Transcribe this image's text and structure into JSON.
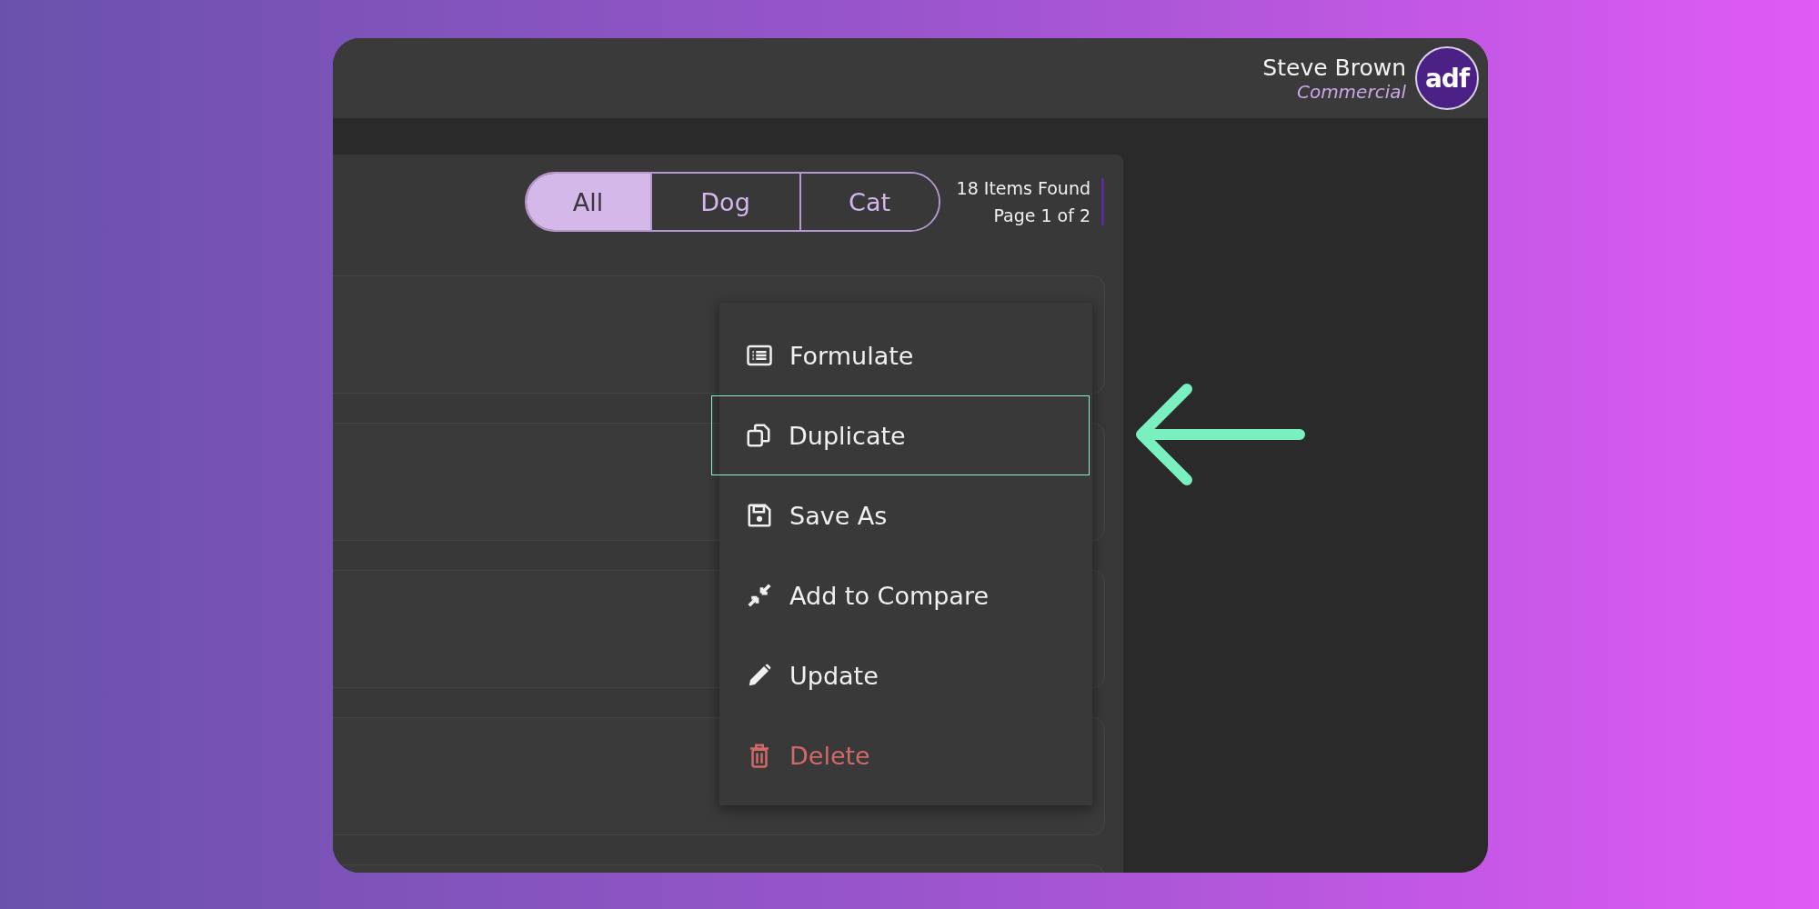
{
  "user": {
    "name": "Steve Brown",
    "role": "Commercial",
    "logo": "adf"
  },
  "filter_tabs": [
    {
      "label": "All",
      "selected": true
    },
    {
      "label": "Dog",
      "selected": false
    },
    {
      "label": "Cat",
      "selected": false
    }
  ],
  "results": {
    "count": "18 Items Found",
    "page": "Page 1 of 2"
  },
  "list_cards": [
    {
      "kind": "card"
    },
    {
      "kind": "card"
    },
    {
      "kind": "card"
    },
    {
      "kind": "card"
    },
    {
      "kind": "card"
    }
  ],
  "context_menu": {
    "items": [
      {
        "label": "Formulate",
        "kind": "action",
        "selected": false
      },
      {
        "label": "Duplicate",
        "kind": "action",
        "selected": true
      },
      {
        "label": "Save As",
        "kind": "action",
        "selected": false
      },
      {
        "label": "Add to Compare",
        "kind": "action",
        "selected": false
      },
      {
        "label": "Update",
        "kind": "action",
        "selected": false
      },
      {
        "label": "Delete",
        "kind": "destructive",
        "selected": false
      }
    ]
  }
}
